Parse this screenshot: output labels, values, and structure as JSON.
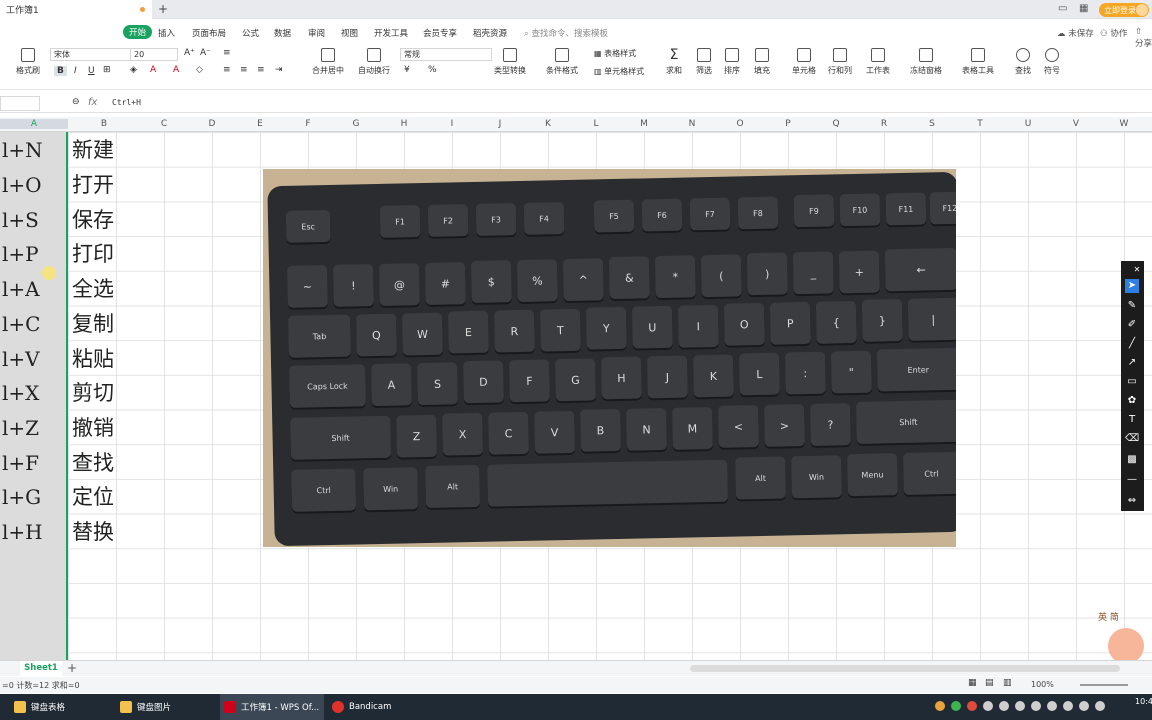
{
  "titlebar": {
    "tab_title": "工作簿1",
    "new_tab": "+",
    "login_label": "立即登录"
  },
  "menu": {
    "items": [
      "开始",
      "插入",
      "页面布局",
      "公式",
      "数据",
      "审阅",
      "视图",
      "开发工具",
      "会员专享",
      "稻壳资源"
    ],
    "active_index": 0,
    "search_placeholder": "查找命令、搜索模板",
    "unsaved": "未保存",
    "collab": "协作",
    "share": "分享"
  },
  "ribbon": {
    "format_painter": "格式刷",
    "font_name": "宋体",
    "font_size": "20",
    "bold": "B",
    "italic": "I",
    "underline": "U",
    "merge_center": "合并居中",
    "wrap": "自动换行",
    "number_format": "常规",
    "type_convert": "类型转换",
    "cond_format": "条件格式",
    "table_style": "表格样式",
    "cell_style": "单元格样式",
    "sum": "求和",
    "filter": "筛选",
    "sort": "排序",
    "fill": "填充",
    "cell": "单元格",
    "rowcol": "行和列",
    "worksheet": "工作表",
    "freeze": "冻结窗格",
    "table_tools": "表格工具",
    "find": "查找",
    "symbol": "符号",
    "currency": "¥",
    "percent": "%"
  },
  "formula_bar": {
    "fx": "fx",
    "formula": "Ctrl+H"
  },
  "columns": [
    "A",
    "B",
    "C",
    "D",
    "E",
    "F",
    "G",
    "H",
    "I",
    "J",
    "K",
    "L",
    "M",
    "N",
    "O",
    "P",
    "Q",
    "R",
    "S",
    "T",
    "U",
    "V",
    "W"
  ],
  "rows": [
    {
      "shortcut": "l+N",
      "action": "新建"
    },
    {
      "shortcut": "l+O",
      "action": "打开"
    },
    {
      "shortcut": "l+S",
      "action": "保存"
    },
    {
      "shortcut": "l+P",
      "action": "打印"
    },
    {
      "shortcut": "l+A",
      "action": "全选"
    },
    {
      "shortcut": "l+C",
      "action": "复制"
    },
    {
      "shortcut": "l+V",
      "action": "粘贴"
    },
    {
      "shortcut": "l+X",
      "action": "剪切"
    },
    {
      "shortcut": "l+Z",
      "action": "撤销"
    },
    {
      "shortcut": "l+F",
      "action": "查找"
    },
    {
      "shortcut": "l+G",
      "action": "定位"
    },
    {
      "shortcut": "l+H",
      "action": "替换"
    }
  ],
  "keyboard_keys": {
    "row0": [
      "Esc",
      "F1",
      "F2",
      "F3",
      "F4",
      "F5",
      "F6",
      "F7",
      "F8",
      "F9",
      "F10",
      "F11",
      "F12"
    ],
    "row1": [
      "~",
      "!",
      "@",
      "#",
      "$",
      "%",
      "^",
      "&",
      "*",
      "(",
      ")",
      "_",
      "+",
      "←"
    ],
    "row2": [
      "Tab",
      "Q",
      "W",
      "E",
      "R",
      "T",
      "Y",
      "U",
      "I",
      "O",
      "P",
      "{",
      "}",
      "|"
    ],
    "row3": [
      "Caps Lock",
      "A",
      "S",
      "D",
      "F",
      "G",
      "H",
      "J",
      "K",
      "L",
      ":",
      "\"",
      "Enter"
    ],
    "row4": [
      "Shift",
      "Z",
      "X",
      "C",
      "V",
      "B",
      "N",
      "M",
      "<",
      ">",
      "?",
      "Shift"
    ],
    "row5": [
      "Ctrl",
      "Win",
      "Alt",
      "",
      "Alt",
      "Win",
      "Menu",
      "Ctrl"
    ]
  },
  "sheet": {
    "tab_name": "Sheet1",
    "add": "+"
  },
  "status": {
    "text": "=0  计数=12  求和=0",
    "zoom": "100%"
  },
  "taskbar": {
    "items": [
      "键盘表格",
      "键盘图片",
      "工作簿1 - WPS Of...",
      "Bandicam"
    ],
    "active_index": 2,
    "clock": "10:4"
  },
  "mascot_text": "英 简"
}
